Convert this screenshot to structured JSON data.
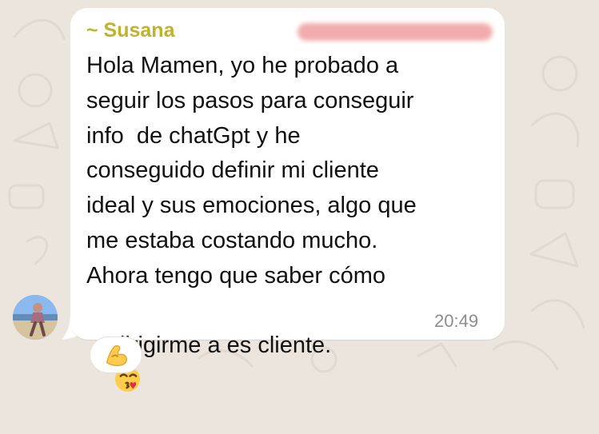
{
  "message": {
    "sender": "~ Susana",
    "lines": [
      "Hola Mamen, yo he probado a",
      "seguir los pasos para conseguir",
      "info  de chatGpt y he",
      "conseguido definir mi cliente",
      "ideal y sus emociones, algo que",
      "me estaba costando mucho.",
      "Ahora tengo que saber cómo",
      "dirigirme a es cliente."
    ],
    "time": "20:49",
    "inline_emoji": "face-throwing-kiss-icon"
  },
  "reaction": {
    "emoji": "flexed-biceps-icon"
  },
  "colors": {
    "background": "#ece5dd",
    "bubble": "#ffffff",
    "sender": "#c0b229",
    "text": "#111111",
    "time": "#8d8d8d",
    "redaction": "#f1a8a8"
  }
}
